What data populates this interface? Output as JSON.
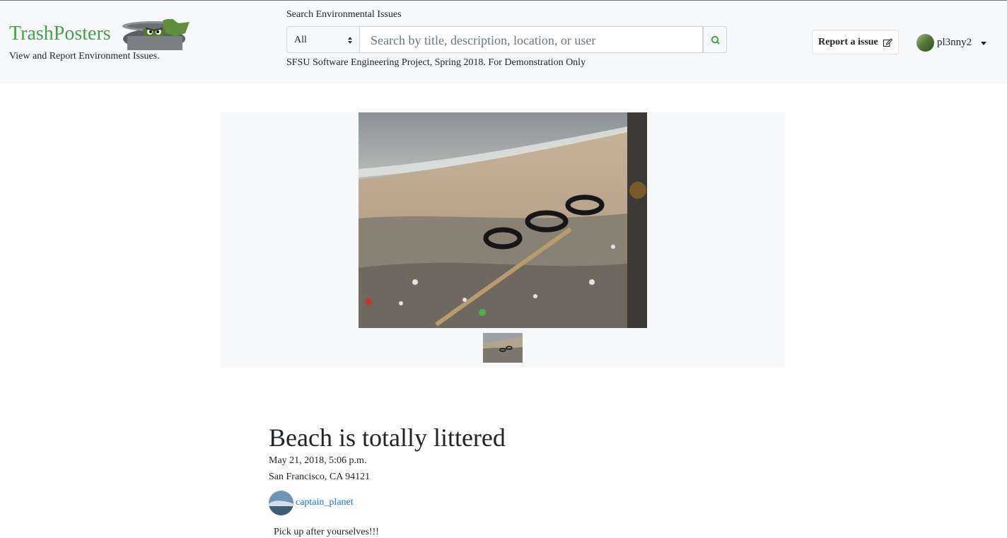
{
  "header": {
    "brand": "TrashPosters",
    "tagline": "View and Report Environment Issues.",
    "search_label": "Search Environmental Issues",
    "category_selected": "All",
    "search_placeholder": "Search by title, description, location, or user",
    "project_note": "SFSU Software Engineering Project, Spring 2018. For Demonstration Only",
    "report_button": "Report a issue",
    "username": "pl3nny2"
  },
  "issue": {
    "title": "Beach is totally littered",
    "date": "May 21, 2018, 5:06 p.m.",
    "location": "San Francisco, CA 94121",
    "poster": "captain_planet",
    "description": "Pick up after yourselves!!!"
  },
  "icons": {
    "search": "search-icon",
    "report": "edit-icon",
    "prev": "chevron-left-icon",
    "next": "chevron-right-icon"
  },
  "colors": {
    "brand": "#46a046",
    "link": "#1a73e8",
    "navbar_bg": "#f6f8fa"
  }
}
